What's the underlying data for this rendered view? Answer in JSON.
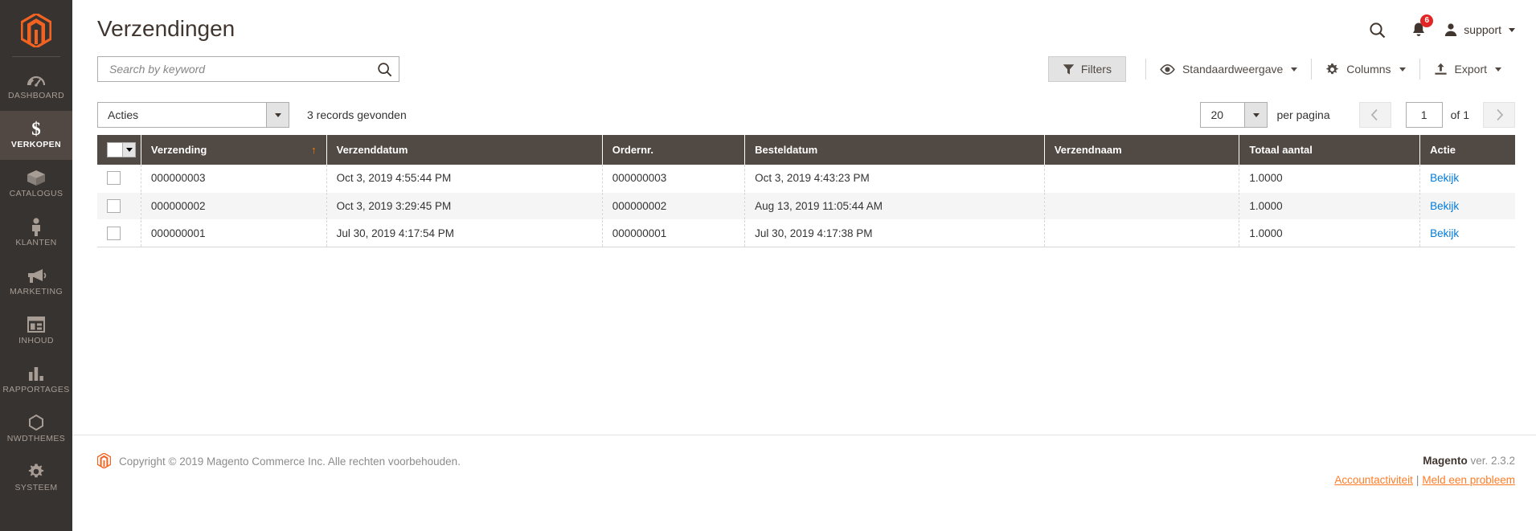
{
  "sidebar": {
    "logo_name": "magento-logo",
    "items": [
      {
        "label": "DASHBOARD",
        "icon": "dashboard-gauge-icon",
        "active": false
      },
      {
        "label": "VERKOPEN",
        "icon": "dollar-sign-icon",
        "active": true
      },
      {
        "label": "CATALOGUS",
        "icon": "box-icon",
        "active": false
      },
      {
        "label": "KLANTEN",
        "icon": "person-icon",
        "active": false
      },
      {
        "label": "MARKETING",
        "icon": "megaphone-icon",
        "active": false
      },
      {
        "label": "INHOUD",
        "icon": "layout-window-icon",
        "active": false
      },
      {
        "label": "RAPPORTAGES",
        "icon": "bar-chart-icon",
        "active": false
      },
      {
        "label": "NWDTHEMES",
        "icon": "hexagon-icon",
        "active": false
      },
      {
        "label": "SYSTEEM",
        "icon": "gear-icon",
        "active": false
      }
    ]
  },
  "header": {
    "title": "Verzendingen",
    "search_icon": "search-icon",
    "notifications": {
      "icon": "bell-icon",
      "count": "6"
    },
    "user": {
      "icon": "user-avatar-icon",
      "name": "support",
      "caret": "chevron-down-icon"
    }
  },
  "search": {
    "placeholder": "Search by keyword",
    "value": "",
    "submit_icon": "search-icon"
  },
  "toolbar": {
    "filters_label": "Filters",
    "filters_icon": "funnel-icon",
    "view_label": "Standaardweergave",
    "view_icon": "eye-icon",
    "columns_label": "Columns",
    "columns_icon": "gear-icon",
    "export_label": "Export",
    "export_icon": "upload-icon"
  },
  "subcontrols": {
    "actions_label": "Acties",
    "records_found": "3 records gevonden",
    "per_page_value": "20",
    "per_page_label": "per pagina",
    "prev_icon": "chevron-left-icon",
    "next_icon": "chevron-right-icon",
    "page_value": "1",
    "page_total_label": "of 1"
  },
  "grid": {
    "columns": [
      {
        "key": "check",
        "label": ""
      },
      {
        "key": "verzending",
        "label": "Verzending",
        "sorted": "asc"
      },
      {
        "key": "verzenddatum",
        "label": "Verzenddatum"
      },
      {
        "key": "ordernr",
        "label": "Ordernr."
      },
      {
        "key": "besteldatum",
        "label": "Besteldatum"
      },
      {
        "key": "verzendnaam",
        "label": "Verzendnaam"
      },
      {
        "key": "totaal_aantal",
        "label": "Totaal aantal"
      },
      {
        "key": "actie",
        "label": "Actie"
      }
    ],
    "sort_asc_glyph": "↑",
    "rows": [
      {
        "verzending": "000000003",
        "verzenddatum": "Oct 3, 2019 4:55:44 PM",
        "ordernr": "000000003",
        "besteldatum": "Oct 3, 2019 4:43:23 PM",
        "verzendnaam": "",
        "totaal_aantal": "1.0000",
        "actie": "Bekijk"
      },
      {
        "verzending": "000000002",
        "verzenddatum": "Oct 3, 2019 3:29:45 PM",
        "ordernr": "000000002",
        "besteldatum": "Aug 13, 2019 11:05:44 AM",
        "verzendnaam": "",
        "totaal_aantal": "1.0000",
        "actie": "Bekijk"
      },
      {
        "verzending": "000000001",
        "verzenddatum": "Jul 30, 2019 4:17:54 PM",
        "ordernr": "000000001",
        "besteldatum": "Jul 30, 2019 4:17:38 PM",
        "verzendnaam": "",
        "totaal_aantal": "1.0000",
        "actie": "Bekijk"
      }
    ]
  },
  "footer": {
    "copyright": "Copyright © 2019 Magento Commerce Inc. Alle rechten voorbehouden.",
    "brand": "Magento",
    "version": " ver. 2.3.2",
    "link_account": "Accountactiviteit",
    "link_separator": "|",
    "link_report": "Meld een probleem"
  },
  "colors": {
    "sidebar_bg": "#373330",
    "sidebar_active": "#524843",
    "table_header": "#514943",
    "accent_orange": "#ff7b26",
    "link_blue": "#007bdb",
    "badge_red": "#e22626",
    "sort_arrow": "#ff8000"
  }
}
